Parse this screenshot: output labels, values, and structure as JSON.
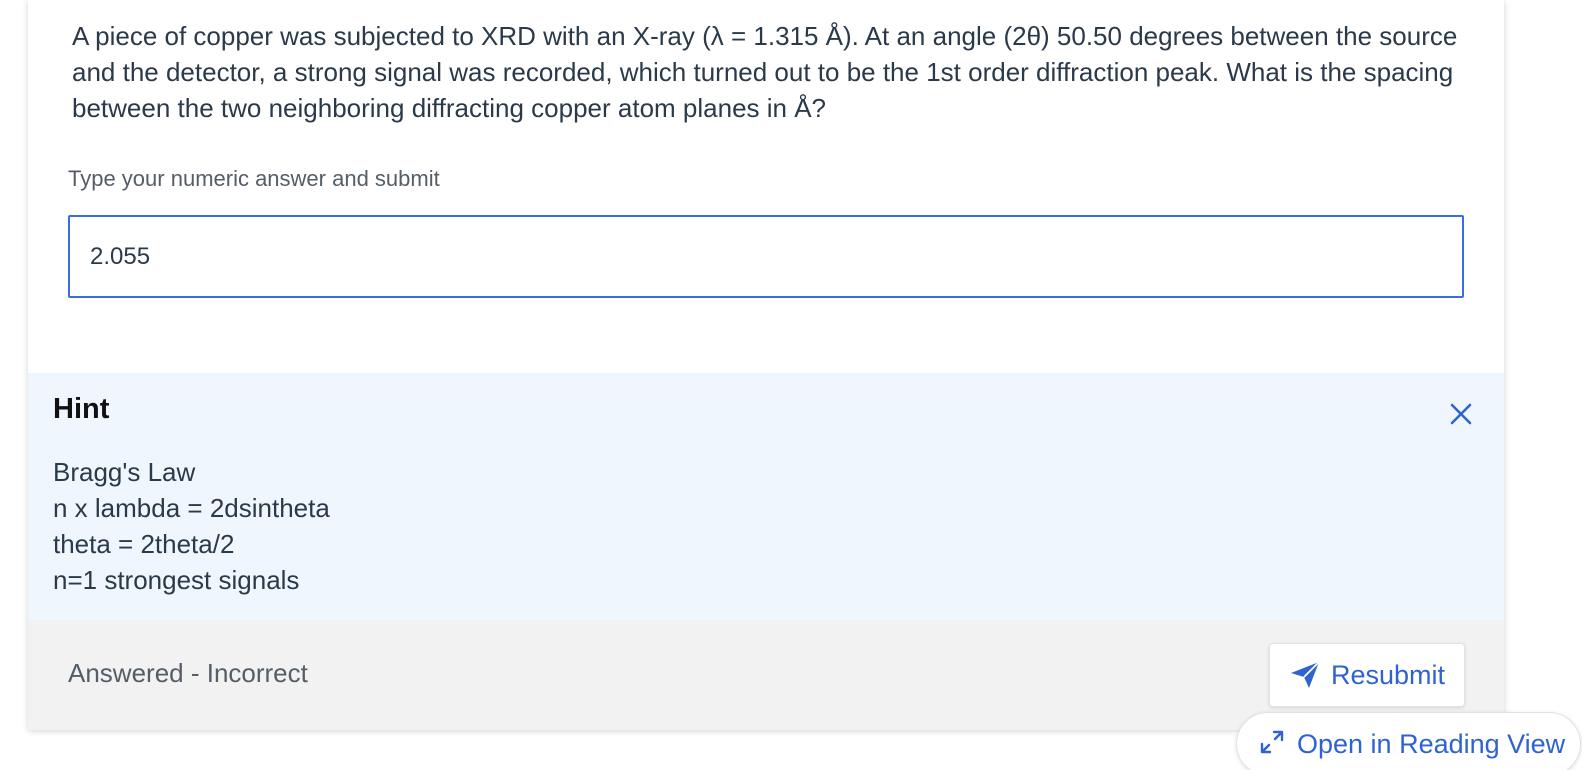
{
  "question": {
    "text": "A piece of copper was subjected to XRD with an X-ray (λ = 1.315 Å). At an angle (2θ) 50.50 degrees between the source and the detector, a strong signal was recorded, which turned out to be the 1st order diffraction peak. What is the spacing between the two neighboring diffracting copper atom planes in Å?"
  },
  "answer": {
    "label": "Type your numeric answer and submit",
    "value": "2.055"
  },
  "hint": {
    "title": "Hint",
    "close_icon": "close-icon",
    "lines": [
      "Bragg's Law",
      "n x lambda = 2dsintheta",
      "theta = 2theta/2",
      "n=1 strongest signals"
    ]
  },
  "footer": {
    "status": "Answered - Incorrect",
    "resubmit_label": "Resubmit",
    "resubmit_icon": "send-icon"
  },
  "reading_view": {
    "label": "Open in Reading View",
    "icon": "expand-icon"
  },
  "colors": {
    "accent": "#2f63d0",
    "input_border": "#3a6fd8",
    "hint_background": "#eff6fd",
    "footer_background": "#f2f2f2",
    "text": "#2b3a4a"
  }
}
